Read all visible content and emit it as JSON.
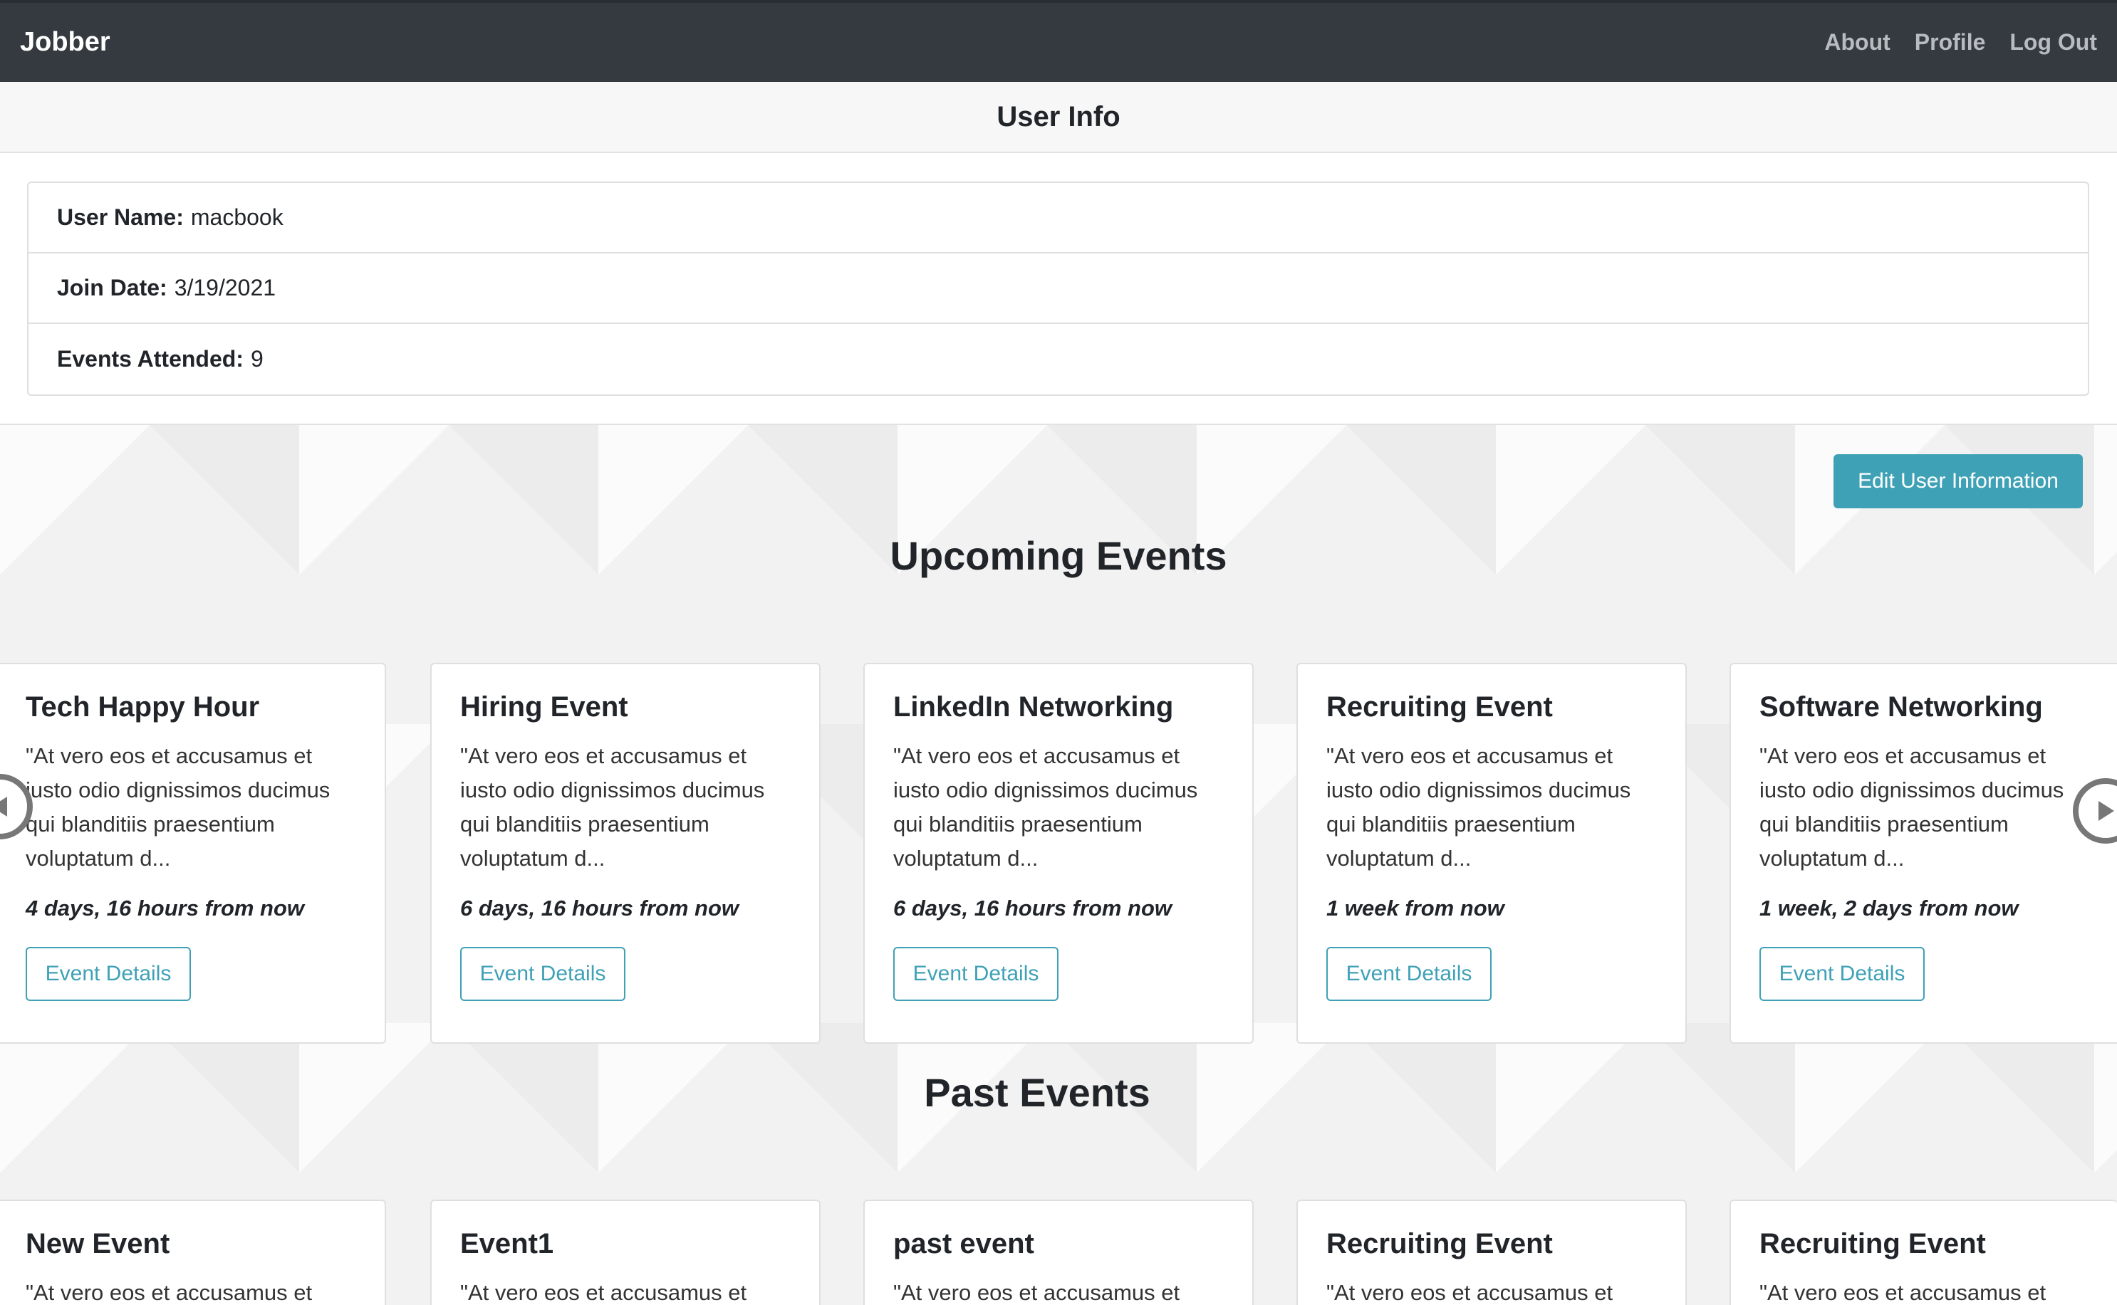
{
  "navbar": {
    "brand": "Jobber",
    "links": [
      "About",
      "Profile",
      "Log Out"
    ]
  },
  "user_info": {
    "header": "User Info",
    "rows": [
      {
        "label": "User Name:",
        "value": "macbook"
      },
      {
        "label": "Join Date:",
        "value": "3/19/2021"
      },
      {
        "label": "Events Attended:",
        "value": "9"
      }
    ],
    "edit_button": "Edit User Information"
  },
  "upcoming": {
    "title": "Upcoming Events",
    "cards": [
      {
        "title": "Tech Happy Hour",
        "text": "\"At vero eos et accusamus et iusto odio dignissimos ducimus qui blanditiis praesentium voluptatum d...",
        "time": "4 days, 16 hours from now",
        "button": "Event Details"
      },
      {
        "title": "Hiring Event",
        "text": "\"At vero eos et accusamus et iusto odio dignissimos ducimus qui blanditiis praesentium voluptatum d...",
        "time": "6 days, 16 hours from now",
        "button": "Event Details"
      },
      {
        "title": "LinkedIn Networking",
        "text": "\"At vero eos et accusamus et iusto odio dignissimos ducimus qui blanditiis praesentium voluptatum d...",
        "time": "6 days, 16 hours from now",
        "button": "Event Details"
      },
      {
        "title": "Recruiting Event",
        "text": "\"At vero eos et accusamus et iusto odio dignissimos ducimus qui blanditiis praesentium voluptatum d...",
        "time": "1 week from now",
        "button": "Event Details"
      },
      {
        "title": "Software Networking",
        "text": "\"At vero eos et accusamus et iusto odio dignissimos ducimus qui blanditiis praesentium voluptatum d...",
        "time": "1 week, 2 days from now",
        "button": "Event Details"
      }
    ]
  },
  "past": {
    "title": "Past Events",
    "cards": [
      {
        "title": "New Event",
        "text": "\"At vero eos et accusamus et"
      },
      {
        "title": "Event1",
        "text": "\"At vero eos et accusamus et"
      },
      {
        "title": "past event",
        "text": "\"At vero eos et accusamus et"
      },
      {
        "title": "Recruiting Event",
        "text": "\"At vero eos et accusamus et"
      },
      {
        "title": "Recruiting Event",
        "text": "\"At vero eos et accusamus et"
      }
    ]
  },
  "colors": {
    "navbar": "#343a40",
    "accent": "#3fa1b6"
  },
  "icons": {
    "prev": "chevron-left-circle-icon",
    "next": "chevron-right-circle-icon"
  }
}
